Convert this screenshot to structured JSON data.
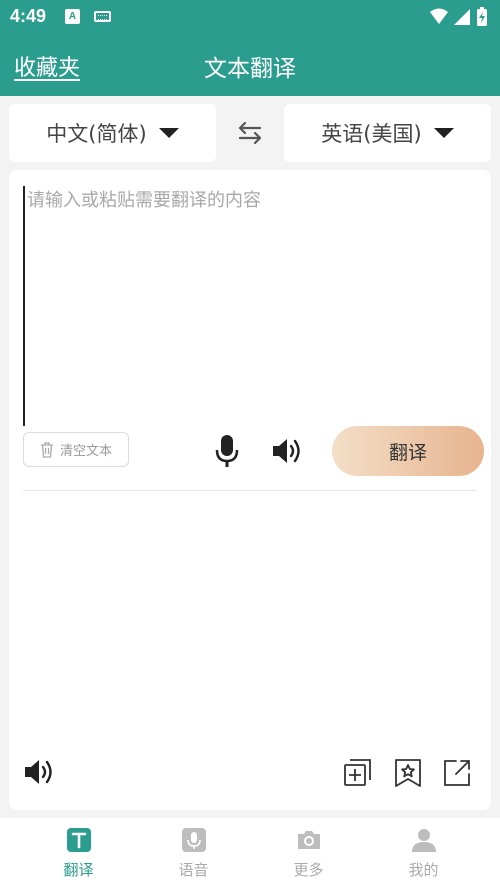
{
  "status_bar": {
    "time": "4:49",
    "badge_letter": "A"
  },
  "app_bar": {
    "favorites_label": "收藏夹",
    "title": "文本翻译"
  },
  "languages": {
    "source": "中文(简体)",
    "target": "英语(美国)"
  },
  "input": {
    "placeholder": "请输入或粘贴需要翻译的内容",
    "value": ""
  },
  "actions": {
    "clear_label": "清空文本",
    "translate_label": "翻译"
  },
  "bottom_nav": {
    "items": [
      {
        "label": "翻译",
        "active": true
      },
      {
        "label": "语音",
        "active": false
      },
      {
        "label": "更多",
        "active": false
      },
      {
        "label": "我的",
        "active": false
      }
    ]
  },
  "colors": {
    "primary": "#2a9d8f",
    "accent_start": "#f4dfc8",
    "accent_end": "#e7b48e",
    "background": "#f3f3f3"
  }
}
